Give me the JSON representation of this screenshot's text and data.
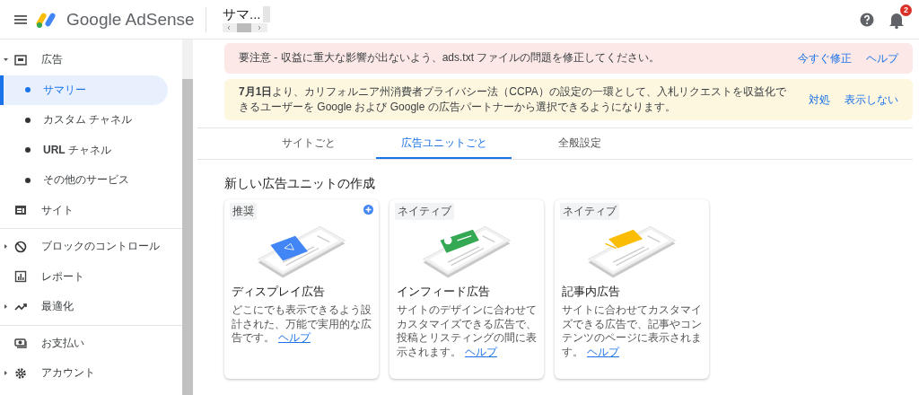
{
  "header": {
    "brand": "Google AdSense",
    "page_title": "サマ...",
    "notification_count": "2"
  },
  "sidebar": {
    "groups": [
      {
        "items": [
          {
            "label": "広告",
            "expanded": true,
            "selected": false,
            "children": [
              {
                "label": "サマリー",
                "selected": true
              },
              {
                "label": "カスタム チャネル",
                "selected": false
              },
              {
                "label": "**URL** チャネル",
                "selected": false
              },
              {
                "label": "その他のサービス",
                "selected": false
              }
            ]
          },
          {
            "label": "サイト",
            "selected": false
          }
        ]
      },
      {
        "items": [
          {
            "label": "ブロックのコントロール",
            "expanded": false,
            "selected": false
          },
          {
            "label": "レポート",
            "selected": false
          },
          {
            "label": "最適化",
            "expanded": false,
            "selected": false
          }
        ]
      },
      {
        "items": [
          {
            "label": "お支払い",
            "selected": false
          },
          {
            "label": "アカウント",
            "expanded": false,
            "selected": false
          }
        ]
      }
    ]
  },
  "alerts": [
    {
      "kind": "error",
      "text": "要注意 - 収益に重大な影響が出ないよう、ads.txt ファイルの問題を修正してください。",
      "actions": [
        "今すぐ修正",
        "ヘルプ"
      ]
    },
    {
      "kind": "warning",
      "text": "**7月1日**より、カリフォルニア州消費者プライバシー法（CCPA）の設定の一環として、入札リクエストを収益化できるユーザーを Google および Google の広告パートナーから選択できるようになります。",
      "actions": [
        "対処",
        "表示しない"
      ]
    }
  ],
  "tabs": [
    {
      "label": "サイトごと",
      "selected": false
    },
    {
      "label": "広告ユニットごと",
      "selected": true
    },
    {
      "label": "全般設定",
      "selected": false
    }
  ],
  "section_title": "新しい広告ユニットの作成",
  "cards": [
    {
      "kind": "display",
      "tag": "推奨",
      "title": "ディスプレイ広告",
      "description": "どこにでも表示できるよう設計された、万能で実用的な広告です。",
      "link": "ヘルプ"
    },
    {
      "kind": "infeed",
      "tag": "ネイティブ",
      "title": "インフィード広告",
      "description": "サイトのデザインに合わせてカスタマイズできる広告で、投稿とリスティングの間に表示されます。",
      "link": "ヘルプ"
    },
    {
      "kind": "inarticle",
      "tag": "ネイティブ",
      "title": "記事内広告",
      "description": "サイトに合わせてカスタマイズできる広告で、記事やコンテンツのページに表示されます。",
      "link": "ヘルプ"
    }
  ]
}
